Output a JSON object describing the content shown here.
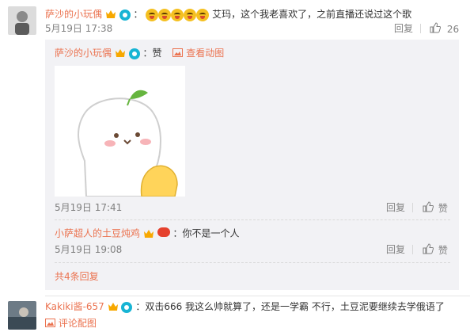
{
  "comment1": {
    "username": "萨沙的小玩偶",
    "text": "艾玛，这个我老喜欢了，之前直播还说过这个歌",
    "emoji_count": 5,
    "time": "5月19日 17:38",
    "reply_label": "回复",
    "like_count": "26"
  },
  "reply1": {
    "username": "萨沙的小玩偶",
    "like_word": "赞",
    "view_gif": "查看动图",
    "time": "5月19日 17:41",
    "reply_label": "回复",
    "like_label": "赞"
  },
  "reply2": {
    "username": "小萨超人的土豆炖鸡",
    "text": "你不是一个人",
    "time": "5月19日 19:08",
    "reply_label": "回复",
    "like_label": "赞"
  },
  "total_replies": "共4条回复",
  "comment2": {
    "username": "Kakiki酱-657",
    "text": "双击666 我这么帅就算了，还是一学霸 不行，土豆泥要继续去学俄语了",
    "view_pic": "评论配图"
  },
  "colors": {
    "username": "#eb7350",
    "muted": "#808080",
    "reply_bg": "#f2f2f5",
    "vip_badge": "#f7a800",
    "circle_badge": "#17b4d4"
  }
}
